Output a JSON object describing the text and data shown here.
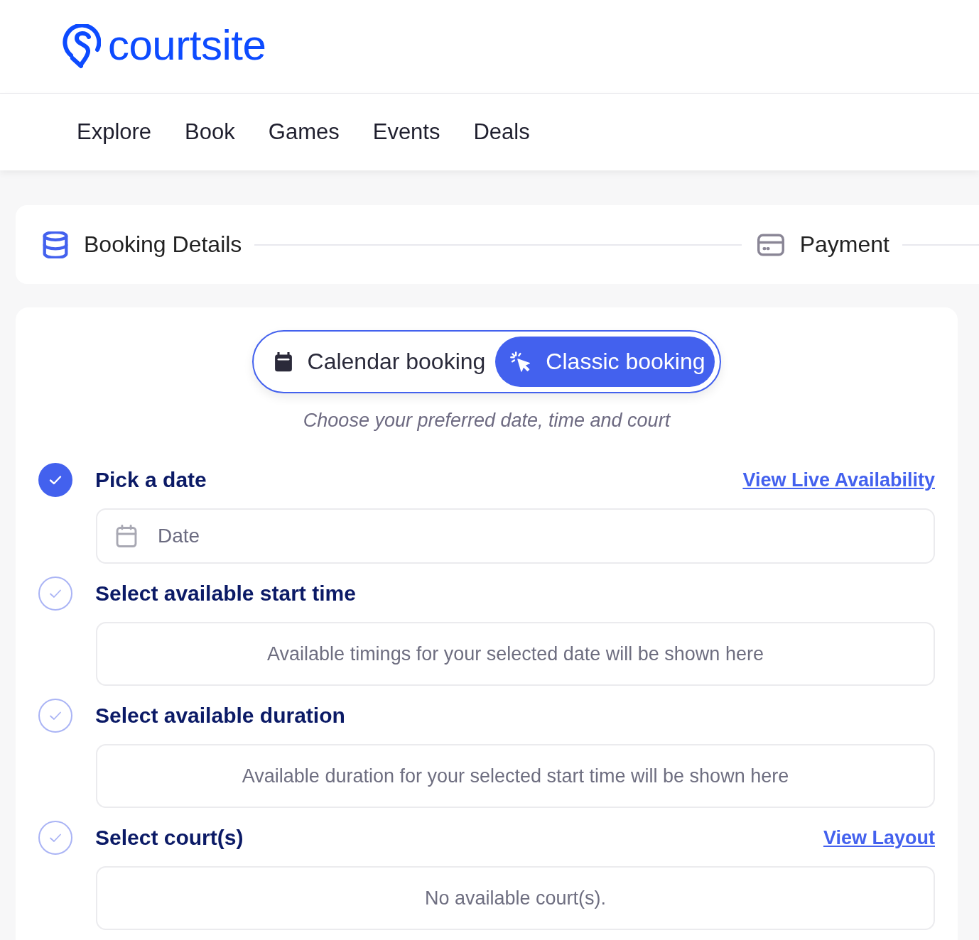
{
  "logo": {
    "text": "courtsite"
  },
  "nav": [
    {
      "label": "Explore"
    },
    {
      "label": "Book"
    },
    {
      "label": "Games"
    },
    {
      "label": "Events"
    },
    {
      "label": "Deals"
    }
  ],
  "stepper": [
    {
      "label": "Booking Details",
      "active": true
    },
    {
      "label": "Payment",
      "active": false
    }
  ],
  "booking_mode": {
    "options": [
      {
        "label": "Calendar booking",
        "selected": false
      },
      {
        "label": "Classic booking",
        "selected": true
      }
    ],
    "hint": "Choose your preferred date, time and court"
  },
  "steps": [
    {
      "title": "Pick a date",
      "completed": true,
      "link": "View Live Availability",
      "kind": "field",
      "placeholder": "Date"
    },
    {
      "title": "Select available start time",
      "completed": false,
      "kind": "message",
      "message": "Available timings for your selected date will be shown here"
    },
    {
      "title": "Select available duration",
      "completed": false,
      "kind": "message",
      "message": "Available duration for your selected start time will be shown here"
    },
    {
      "title": "Select court(s)",
      "completed": false,
      "link": "View Layout",
      "kind": "message",
      "message": "No available court(s)."
    }
  ]
}
